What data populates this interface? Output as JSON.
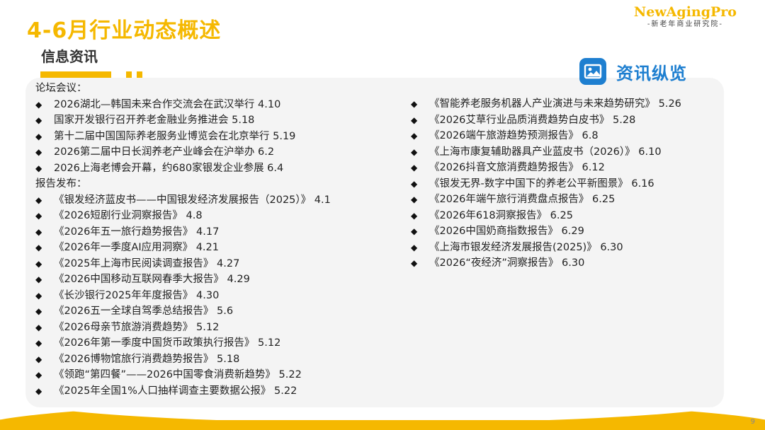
{
  "header": {
    "title": "4-6月行业动态概述",
    "subtitle": "信息资讯",
    "brand_name": "NewAgingPro",
    "brand_sub": "-新老年商业研究院-"
  },
  "badge": {
    "label": "资讯纵览",
    "icon": "image-icon",
    "color": "#1E7FD0"
  },
  "accent_color": "#F5B800",
  "forums": {
    "heading": "论坛会议：",
    "items": [
      "2026湖北—韩国未来合作交流会在武汉举行 4.10",
      "国家开发银行召开养老金融业务推进会 5.18",
      "第十二届中国国际养老服务业博览会在北京举行 5.19",
      "2026第二届中日长润养老产业峰会在沪举办 6.2",
      "2026上海老博会开幕，约680家银发企业参展 6.4"
    ]
  },
  "reports": {
    "heading": "报告发布：",
    "left_items": [
      "《银发经济蓝皮书——中国银发经济发展报告（2025）》 4.1",
      "《2026短剧行业洞察报告》 4.8",
      "《2026年五一旅行趋势报告》 4.17",
      "《2026年一季度AI应用洞察》 4.21",
      "《2025年上海市民阅读调查报告》 4.27",
      "《2026中国移动互联网春季大报告》 4.29",
      "《长沙银行2025年年度报告》 4.30",
      "《2026五一全球自驾季总结报告》 5.6",
      "《2026母亲节旅游消费趋势》 5.12",
      "《2026年第一季度中国货币政策执行报告》 5.12",
      "《2026博物馆旅行消费趋势报告》 5.18",
      "《领跑“第四餐”——2026中国零食消费新趋势》 5.22",
      "《2025年全国1%人口抽样调查主要数据公报》 5.22"
    ],
    "right_items": [
      "《智能养老服务机器人产业演进与未来趋势研究》 5.26",
      "《2026艾草行业品质消费趋势白皮书》 5.28",
      "《2026端午旅游趋势预测报告》 6.8",
      "《上海市康复辅助器具产业蓝皮书（2026）》 6.10",
      "《2026抖音文旅消费趋势报告》 6.12",
      "《银发无界-数字中国下的养老公平新图景》 6.16",
      "《2026年端午旅行消费盘点报告》 6.25",
      "《2026年618洞察报告》 6.25",
      "《2026中国奶商指数报告》 6.29",
      "《上海市银发经济发展报告(2025)》 6.30",
      "《2026“夜经济”洞察报告》 6.30"
    ]
  },
  "page_number": "9"
}
